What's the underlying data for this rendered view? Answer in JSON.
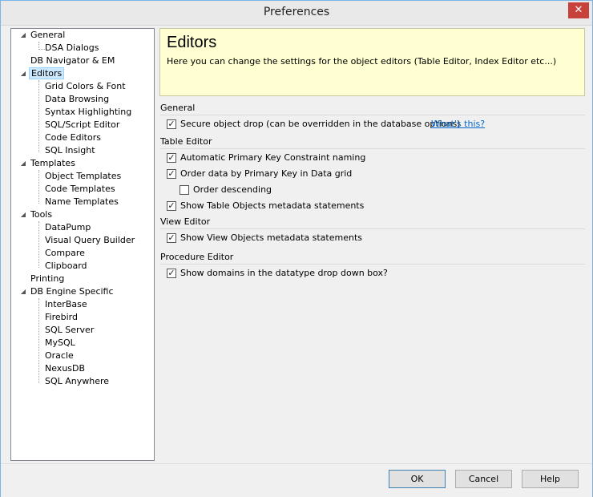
{
  "window": {
    "title": "Preferences"
  },
  "titlebar": {
    "close_glyph": "✕"
  },
  "tree": {
    "expand_glyph": "◢",
    "items": [
      {
        "label": "General"
      },
      {
        "label": "DSA Dialogs"
      },
      {
        "label": "DB Navigator & EM"
      },
      {
        "label": "Editors",
        "selected": true
      },
      {
        "label": "Grid Colors & Font"
      },
      {
        "label": "Data Browsing"
      },
      {
        "label": "Syntax Highlighting"
      },
      {
        "label": "SQL/Script Editor"
      },
      {
        "label": "Code Editors"
      },
      {
        "label": "SQL Insight"
      },
      {
        "label": "Templates"
      },
      {
        "label": "Object Templates"
      },
      {
        "label": "Code Templates"
      },
      {
        "label": "Name Templates"
      },
      {
        "label": "Tools"
      },
      {
        "label": "DataPump"
      },
      {
        "label": "Visual Query Builder"
      },
      {
        "label": "Compare"
      },
      {
        "label": "Clipboard"
      },
      {
        "label": "Printing"
      },
      {
        "label": "DB Engine Specific"
      },
      {
        "label": "InterBase"
      },
      {
        "label": "Firebird"
      },
      {
        "label": "SQL Server"
      },
      {
        "label": "MySQL"
      },
      {
        "label": "Oracle"
      },
      {
        "label": "NexusDB"
      },
      {
        "label": "SQL Anywhere"
      }
    ]
  },
  "header": {
    "title": "Editors",
    "description": "Here you can change the settings for the object editors (Table Editor, Index Editor etc...)"
  },
  "sections": {
    "general": "General",
    "table_editor": "Table Editor",
    "view_editor": "View Editor",
    "procedure_editor": "Procedure Editor"
  },
  "options": {
    "check_glyph": "✓",
    "secure_drop": {
      "label": "Secure object drop (can be overridden in the database options)",
      "checked": true
    },
    "whats_this": "What's this?",
    "auto_pk_naming": {
      "label": "Automatic Primary Key Constraint naming",
      "checked": true
    },
    "order_by_pk": {
      "label": "Order data by Primary Key in Data grid",
      "checked": true
    },
    "order_desc": {
      "label": "Order descending",
      "checked": false
    },
    "show_table_metadata": {
      "label": "Show Table Objects metadata statements",
      "checked": true
    },
    "show_view_metadata": {
      "label": "Show View Objects metadata statements",
      "checked": true
    },
    "show_domains": {
      "label": "Show domains in the datatype drop down box?",
      "checked": true
    }
  },
  "buttons": {
    "ok": "OK",
    "cancel": "Cancel",
    "help": "Help"
  }
}
